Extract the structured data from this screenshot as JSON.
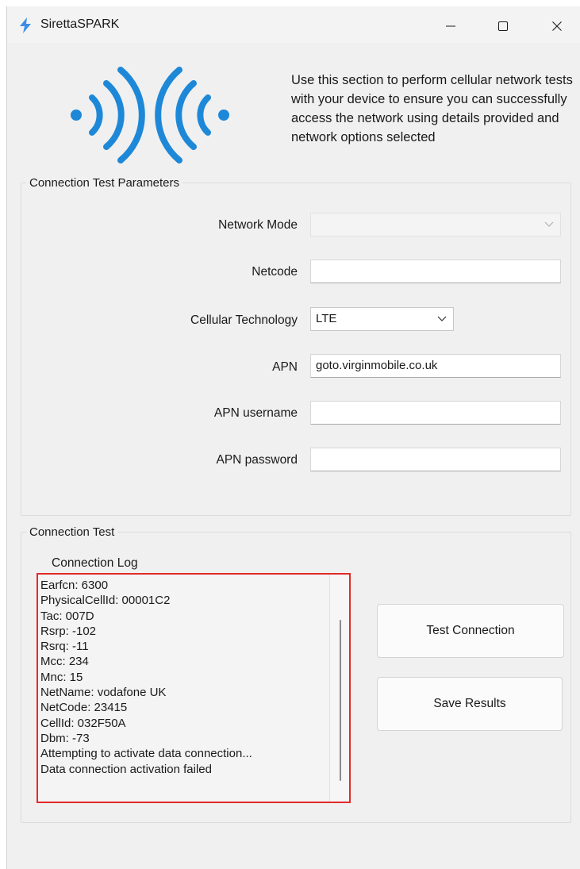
{
  "window": {
    "title": "SirettaSPARK",
    "controls": {
      "minimize": "minimize",
      "maximize": "maximize",
      "close": "close"
    }
  },
  "header": {
    "logo_icon": "cellular-signal-waves-icon",
    "description": "Use this section to perform cellular network tests with your device to ensure you can successfully access the network using details provided and network options selected"
  },
  "parameters": {
    "legend": "Connection Test Parameters",
    "network_mode": {
      "label": "Network Mode",
      "value": ""
    },
    "netcode": {
      "label": "Netcode",
      "value": ""
    },
    "cellular_technology": {
      "label": "Cellular Technology",
      "value": "LTE"
    },
    "apn": {
      "label": "APN",
      "value": "goto.virginmobile.co.uk"
    },
    "apn_username": {
      "label": "APN username",
      "value": ""
    },
    "apn_password": {
      "label": "APN password",
      "value": ""
    }
  },
  "connection_test": {
    "legend": "Connection Test",
    "log_label": "Connection Log",
    "log_lines": [
      "Earfcn: 6300",
      "PhysicalCellId: 00001C2",
      "Tac: 007D",
      "Rsrp: -102",
      "Rsrq: -11",
      "Mcc: 234",
      "Mnc: 15",
      "NetName: vodafone UK",
      "NetCode: 23415",
      "CellId: 032F50A",
      "Dbm: -73",
      "Attempting to activate data connection...",
      "Data connection activation failed"
    ],
    "test_button": "Test Connection",
    "save_button": "Save Results"
  },
  "colors": {
    "accent_blue": "#1e88d8",
    "highlight_red": "#e22b2b",
    "window_bg": "#f0f0f0"
  }
}
